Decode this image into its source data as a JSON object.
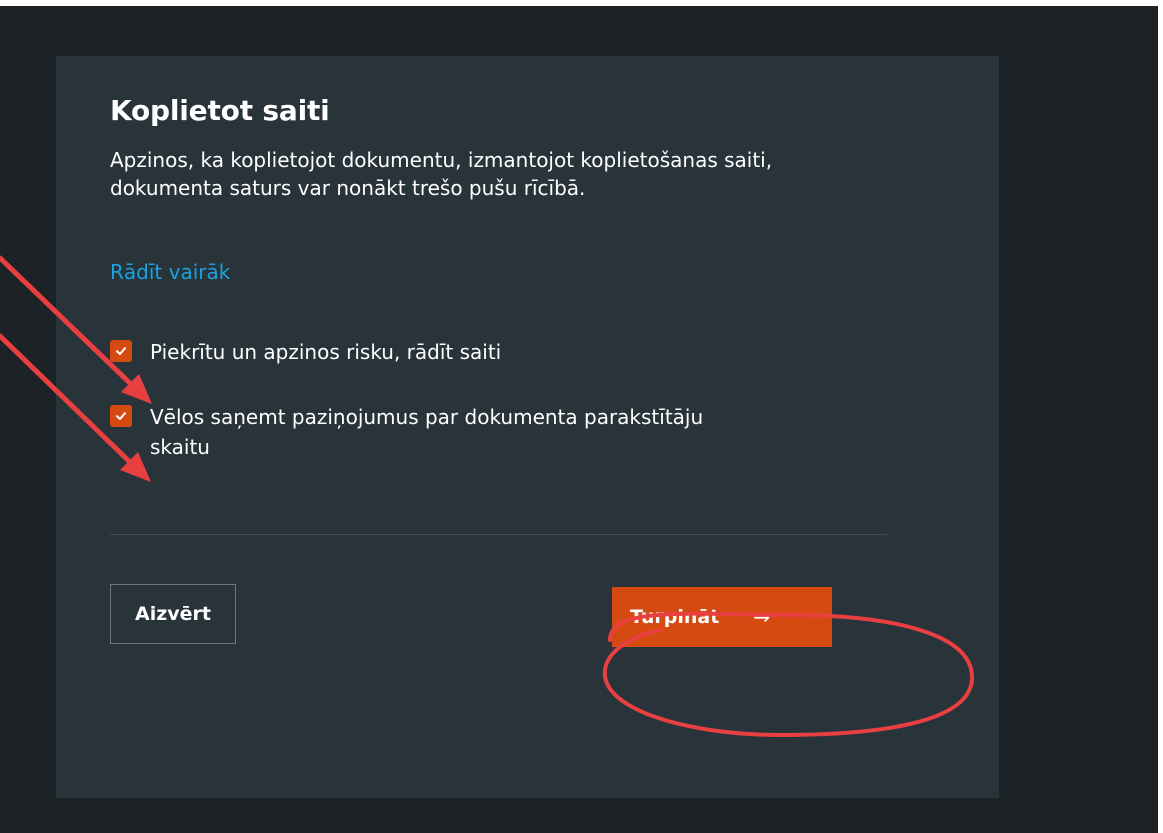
{
  "dialog": {
    "title": "Koplietot saiti",
    "description": "Apzinos, ka koplietojot dokumentu, izmantojot koplietošanas saiti, dokumenta saturs var nonākt trešo pušu rīcībā.",
    "show_more": "Rādīt vairāk",
    "checkboxes": [
      {
        "label": "Piekrītu un apzinos risku, rādīt saiti",
        "checked": true
      },
      {
        "label": "Vēlos saņemt paziņojumus par dokumenta parakstītāju skaitu",
        "checked": true
      }
    ],
    "close_label": "Aizvērt",
    "continue_label": "Turpināt",
    "continue_icon": "arrow-right-icon"
  },
  "colors": {
    "backdrop": "#1c2225",
    "dialog_bg": "#28333a",
    "accent": "#d54a10",
    "link": "#1aa3e0",
    "annotation": "#e84040"
  }
}
